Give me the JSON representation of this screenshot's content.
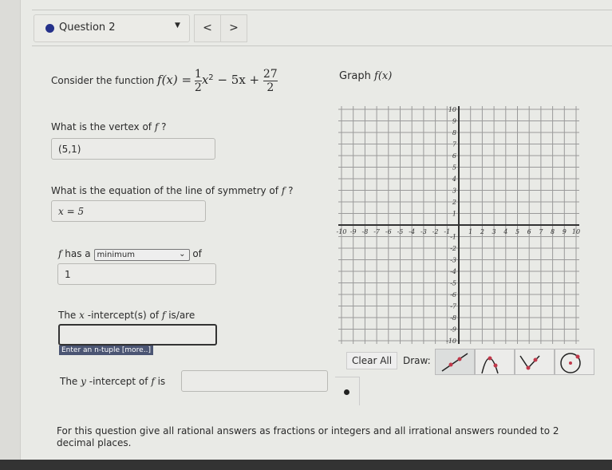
{
  "header": {
    "question_label": "Question 2",
    "prev": "<",
    "next": ">"
  },
  "problem": {
    "intro": "Consider the function",
    "function_lhs": "f(x) =",
    "coef_num": "1",
    "coef_den": "2",
    "x_sq": "x",
    "exp": "2",
    "middle": " − 5x + ",
    "const_num": "27",
    "const_den": "2"
  },
  "q_vertex": {
    "label": "What is the vertex of",
    "label_f": "f",
    "label_end": "?",
    "value": "(5,1)"
  },
  "q_symmetry": {
    "label": "What is the equation of the line of symmetry of",
    "label_f": "f",
    "label_end": "?",
    "value": "x = 5"
  },
  "q_extreme": {
    "f": "f",
    "has_a": "has a",
    "select_value": "minimum",
    "of": "of",
    "value": "1"
  },
  "q_xint": {
    "label_pre": "The",
    "x": "x",
    "label_post": "-intercept(s) of",
    "f": "f",
    "label_end": "is/are",
    "value": "",
    "hint": "Enter an n-tuple [more..]"
  },
  "q_yint": {
    "label_pre": "The",
    "y": "y",
    "label_post": "-intercept of",
    "f": "f",
    "label_end": "is",
    "value": ""
  },
  "graph": {
    "title": "Graph",
    "title_f": "f(x)",
    "xlim": [
      -10,
      10
    ],
    "ylim": [
      -10,
      10
    ],
    "grid": true,
    "clear_all": "Clear All",
    "draw_label": "Draw:",
    "tools": [
      "line-tool-icon",
      "parabola-tool-icon",
      "absolute-value-tool-icon",
      "circle-tool-icon"
    ],
    "active_tool": "line-tool-icon",
    "point_tool": "point-tool-icon"
  },
  "footer": {
    "note": "For this question give all rational answers as fractions or integers and all irrational answers rounded to 2 decimal places."
  },
  "colors": {
    "accent": "#25318a",
    "tool_point": "#c0394b"
  }
}
